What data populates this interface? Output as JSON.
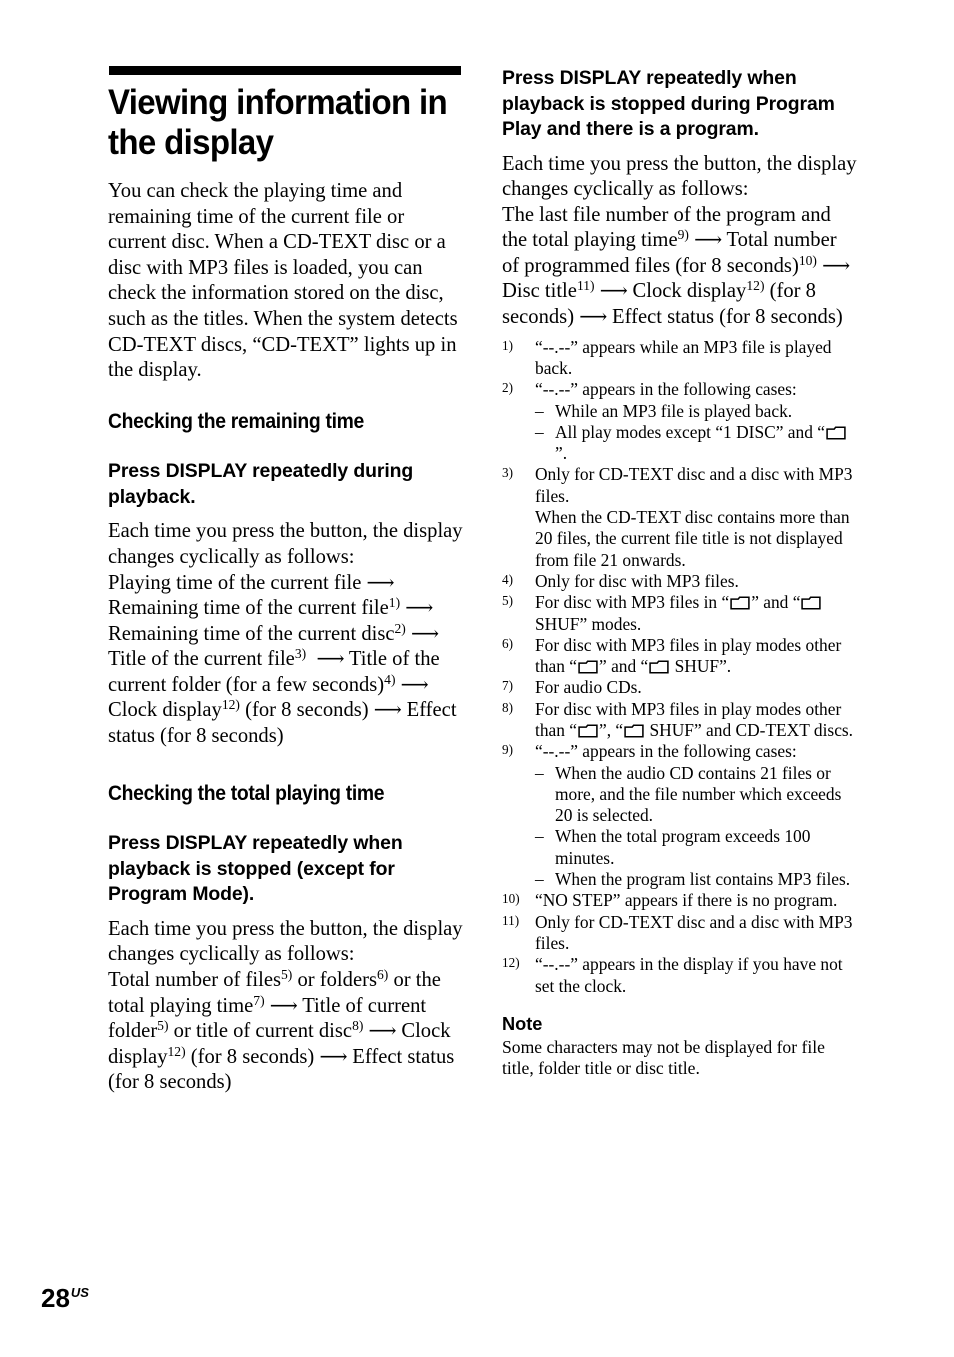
{
  "page": {
    "number": "28",
    "region_suffix": "US"
  },
  "title": "Viewing information in the display",
  "intro": "You can check the playing time and remaining time of the current file or current disc. When a CD-TEXT disc or a disc with MP3 files is loaded, you can check the information stored on the disc, such as the titles. When the system detects CD-TEXT discs, “CD-TEXT” lights up in the display.",
  "left_column": {
    "section1": {
      "heading": "Checking the remaining time",
      "instruction": "Press DISPLAY repeatedly during playback.",
      "lead": "Each time you press the button, the display changes cyclically as follows:",
      "sequence_parts": {
        "p1": "Playing time of the current file",
        "p2": "Remaining time of the current file",
        "p2_sup": "1)",
        "p3": "Remaining time of the current disc",
        "p3_sup": "2)",
        "p4": "Title of the current file",
        "p4_sup": "3)",
        "p5": "Title of the current folder (for a few seconds)",
        "p5_sup": "4)",
        "p6": "Clock display",
        "p6_sup": "12)",
        "p6_tail": "(for 8 seconds)",
        "p7": "Effect status (for 8 seconds)"
      }
    },
    "section2": {
      "heading": "Checking the total playing time",
      "instruction": "Press DISPLAY repeatedly when playback is stopped (except for Program Mode).",
      "lead": "Each time you press the button, the display changes cyclically as follows:",
      "sequence_parts": {
        "p1a": "Total number of files",
        "p1a_sup": "5)",
        "p1b": "or folders",
        "p1b_sup": "6)",
        "p1c": "or the total playing time",
        "p1c_sup": "7)",
        "p2a": "Title of current folder",
        "p2a_sup": "5)",
        "p2b": "or title of current disc",
        "p2b_sup": "8)",
        "p3": "Clock display",
        "p3_sup": "12)",
        "p3_tail": "(for 8 seconds)",
        "p4": "Effect status (for 8 seconds)"
      }
    }
  },
  "right_column": {
    "section3": {
      "instruction": "Press DISPLAY repeatedly when playback is stopped during Program Play and there is a program.",
      "lead": "Each time you press the button, the display changes cyclically as follows:",
      "sequence_parts": {
        "p1": "The last file number of the program and the total playing time",
        "p1_sup": "9)",
        "p2": "Total number of programmed files (for 8 seconds)",
        "p2_sup": "10)",
        "p3": "Disc title",
        "p3_sup": "11)",
        "p4": "Clock display",
        "p4_sup": "12)",
        "p4_tail": "(for 8 seconds)",
        "p5": "Effect status (for 8 seconds)"
      }
    },
    "footnotes": [
      {
        "marker": "1)",
        "text": "“--.--” appears while an MP3 file is played back."
      },
      {
        "marker": "2)",
        "text": "“--.--” appears in the following cases:",
        "sub": [
          {
            "dash": "–",
            "text": "While an MP3 file is played back."
          },
          {
            "dash": "–",
            "text_before": "All play modes except “1 DISC” and “",
            "icon": "folder-icon",
            "text_after": "”."
          }
        ]
      },
      {
        "marker": "3)",
        "text": "Only for CD-TEXT disc and a disc with MP3 files.",
        "extra": "When the CD-TEXT disc contains more than 20 files, the current file title is not displayed from file 21 onwards."
      },
      {
        "marker": "4)",
        "text": "Only for disc with MP3 files."
      },
      {
        "marker": "5)",
        "text_before": "For disc with MP3 files in “",
        "icon": "folder-icon",
        "text_mid": "” and “",
        "icon2": "folder-icon",
        "text_after": " SHUF” modes."
      },
      {
        "marker": "6)",
        "text_before": "For disc with MP3 files in play modes other than “",
        "icon": "folder-icon",
        "text_mid": "” and “",
        "icon2": "folder-icon",
        "text_after": " SHUF”."
      },
      {
        "marker": "7)",
        "text": "For audio CDs."
      },
      {
        "marker": "8)",
        "text_before": "For disc with MP3 files in play modes other than “",
        "icon": "folder-icon",
        "text_mid": "”, “",
        "icon2": "folder-icon",
        "text_after": " SHUF” and CD-TEXT discs."
      },
      {
        "marker": "9)",
        "text": "“--.--” appears in the following cases:",
        "sub": [
          {
            "dash": "–",
            "text": "When the audio CD contains 21 files or more, and the file number which exceeds 20 is selected."
          },
          {
            "dash": "–",
            "text": "When the total program exceeds 100 minutes."
          },
          {
            "dash": "–",
            "text": "When the program list contains MP3 files."
          }
        ]
      },
      {
        "marker": "10)",
        "text": "“NO STEP” appears if there is no program."
      },
      {
        "marker": "11)",
        "text": "Only for CD-TEXT disc and a disc with MP3 files."
      },
      {
        "marker": "12)",
        "text": "“--.--” appears in the display if you have not set the clock."
      }
    ],
    "note": {
      "heading": "Note",
      "text": "Some characters may not be displayed for file title, folder title or disc title."
    }
  },
  "symbols": {
    "arrow": "⟶",
    "folder_icon_name": "folder-icon"
  }
}
